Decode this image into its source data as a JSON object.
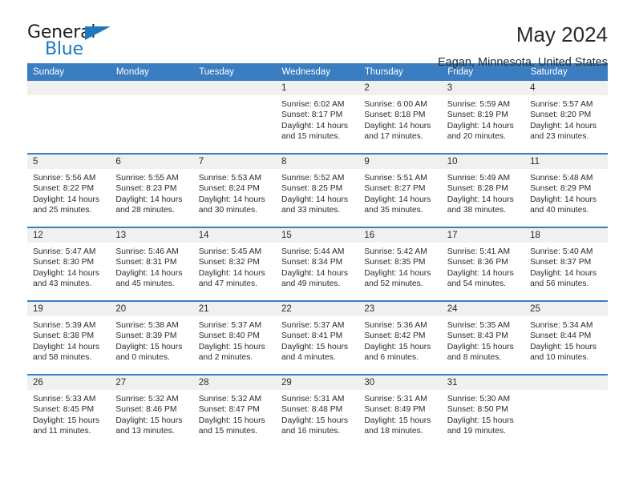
{
  "brand": {
    "name_top": "General",
    "name_bottom": "Blue",
    "accent_color": "#1c79c0"
  },
  "header": {
    "title": "May 2024",
    "subtitle": "Eagan, Minnesota, United States"
  },
  "colors": {
    "header_row_bg": "#3a7dc0",
    "header_row_text": "#ffffff",
    "daynum_band_bg": "#f0f0f0",
    "row_separator": "#3a7dc0",
    "cell_text": "#2b2b2b"
  },
  "weekday_headers": [
    "Sunday",
    "Monday",
    "Tuesday",
    "Wednesday",
    "Thursday",
    "Friday",
    "Saturday"
  ],
  "labels": {
    "sunrise_prefix": "Sunrise:",
    "sunset_prefix": "Sunset:",
    "daylight_prefix": "Daylight:"
  },
  "weeks": [
    [
      {
        "day": "",
        "sunrise": "",
        "sunset": "",
        "daylight": "",
        "empty": true
      },
      {
        "day": "",
        "sunrise": "",
        "sunset": "",
        "daylight": "",
        "empty": true
      },
      {
        "day": "",
        "sunrise": "",
        "sunset": "",
        "daylight": "",
        "empty": true
      },
      {
        "day": "1",
        "sunrise": "Sunrise: 6:02 AM",
        "sunset": "Sunset: 8:17 PM",
        "daylight": "Daylight: 14 hours and 15 minutes."
      },
      {
        "day": "2",
        "sunrise": "Sunrise: 6:00 AM",
        "sunset": "Sunset: 8:18 PM",
        "daylight": "Daylight: 14 hours and 17 minutes."
      },
      {
        "day": "3",
        "sunrise": "Sunrise: 5:59 AM",
        "sunset": "Sunset: 8:19 PM",
        "daylight": "Daylight: 14 hours and 20 minutes."
      },
      {
        "day": "4",
        "sunrise": "Sunrise: 5:57 AM",
        "sunset": "Sunset: 8:20 PM",
        "daylight": "Daylight: 14 hours and 23 minutes."
      }
    ],
    [
      {
        "day": "5",
        "sunrise": "Sunrise: 5:56 AM",
        "sunset": "Sunset: 8:22 PM",
        "daylight": "Daylight: 14 hours and 25 minutes."
      },
      {
        "day": "6",
        "sunrise": "Sunrise: 5:55 AM",
        "sunset": "Sunset: 8:23 PM",
        "daylight": "Daylight: 14 hours and 28 minutes."
      },
      {
        "day": "7",
        "sunrise": "Sunrise: 5:53 AM",
        "sunset": "Sunset: 8:24 PM",
        "daylight": "Daylight: 14 hours and 30 minutes."
      },
      {
        "day": "8",
        "sunrise": "Sunrise: 5:52 AM",
        "sunset": "Sunset: 8:25 PM",
        "daylight": "Daylight: 14 hours and 33 minutes."
      },
      {
        "day": "9",
        "sunrise": "Sunrise: 5:51 AM",
        "sunset": "Sunset: 8:27 PM",
        "daylight": "Daylight: 14 hours and 35 minutes."
      },
      {
        "day": "10",
        "sunrise": "Sunrise: 5:49 AM",
        "sunset": "Sunset: 8:28 PM",
        "daylight": "Daylight: 14 hours and 38 minutes."
      },
      {
        "day": "11",
        "sunrise": "Sunrise: 5:48 AM",
        "sunset": "Sunset: 8:29 PM",
        "daylight": "Daylight: 14 hours and 40 minutes."
      }
    ],
    [
      {
        "day": "12",
        "sunrise": "Sunrise: 5:47 AM",
        "sunset": "Sunset: 8:30 PM",
        "daylight": "Daylight: 14 hours and 43 minutes."
      },
      {
        "day": "13",
        "sunrise": "Sunrise: 5:46 AM",
        "sunset": "Sunset: 8:31 PM",
        "daylight": "Daylight: 14 hours and 45 minutes."
      },
      {
        "day": "14",
        "sunrise": "Sunrise: 5:45 AM",
        "sunset": "Sunset: 8:32 PM",
        "daylight": "Daylight: 14 hours and 47 minutes."
      },
      {
        "day": "15",
        "sunrise": "Sunrise: 5:44 AM",
        "sunset": "Sunset: 8:34 PM",
        "daylight": "Daylight: 14 hours and 49 minutes."
      },
      {
        "day": "16",
        "sunrise": "Sunrise: 5:42 AM",
        "sunset": "Sunset: 8:35 PM",
        "daylight": "Daylight: 14 hours and 52 minutes."
      },
      {
        "day": "17",
        "sunrise": "Sunrise: 5:41 AM",
        "sunset": "Sunset: 8:36 PM",
        "daylight": "Daylight: 14 hours and 54 minutes."
      },
      {
        "day": "18",
        "sunrise": "Sunrise: 5:40 AM",
        "sunset": "Sunset: 8:37 PM",
        "daylight": "Daylight: 14 hours and 56 minutes."
      }
    ],
    [
      {
        "day": "19",
        "sunrise": "Sunrise: 5:39 AM",
        "sunset": "Sunset: 8:38 PM",
        "daylight": "Daylight: 14 hours and 58 minutes."
      },
      {
        "day": "20",
        "sunrise": "Sunrise: 5:38 AM",
        "sunset": "Sunset: 8:39 PM",
        "daylight": "Daylight: 15 hours and 0 minutes."
      },
      {
        "day": "21",
        "sunrise": "Sunrise: 5:37 AM",
        "sunset": "Sunset: 8:40 PM",
        "daylight": "Daylight: 15 hours and 2 minutes."
      },
      {
        "day": "22",
        "sunrise": "Sunrise: 5:37 AM",
        "sunset": "Sunset: 8:41 PM",
        "daylight": "Daylight: 15 hours and 4 minutes."
      },
      {
        "day": "23",
        "sunrise": "Sunrise: 5:36 AM",
        "sunset": "Sunset: 8:42 PM",
        "daylight": "Daylight: 15 hours and 6 minutes."
      },
      {
        "day": "24",
        "sunrise": "Sunrise: 5:35 AM",
        "sunset": "Sunset: 8:43 PM",
        "daylight": "Daylight: 15 hours and 8 minutes."
      },
      {
        "day": "25",
        "sunrise": "Sunrise: 5:34 AM",
        "sunset": "Sunset: 8:44 PM",
        "daylight": "Daylight: 15 hours and 10 minutes."
      }
    ],
    [
      {
        "day": "26",
        "sunrise": "Sunrise: 5:33 AM",
        "sunset": "Sunset: 8:45 PM",
        "daylight": "Daylight: 15 hours and 11 minutes."
      },
      {
        "day": "27",
        "sunrise": "Sunrise: 5:32 AM",
        "sunset": "Sunset: 8:46 PM",
        "daylight": "Daylight: 15 hours and 13 minutes."
      },
      {
        "day": "28",
        "sunrise": "Sunrise: 5:32 AM",
        "sunset": "Sunset: 8:47 PM",
        "daylight": "Daylight: 15 hours and 15 minutes."
      },
      {
        "day": "29",
        "sunrise": "Sunrise: 5:31 AM",
        "sunset": "Sunset: 8:48 PM",
        "daylight": "Daylight: 15 hours and 16 minutes."
      },
      {
        "day": "30",
        "sunrise": "Sunrise: 5:31 AM",
        "sunset": "Sunset: 8:49 PM",
        "daylight": "Daylight: 15 hours and 18 minutes."
      },
      {
        "day": "31",
        "sunrise": "Sunrise: 5:30 AM",
        "sunset": "Sunset: 8:50 PM",
        "daylight": "Daylight: 15 hours and 19 minutes."
      },
      {
        "day": "",
        "sunrise": "",
        "sunset": "",
        "daylight": "",
        "empty": true
      }
    ]
  ]
}
